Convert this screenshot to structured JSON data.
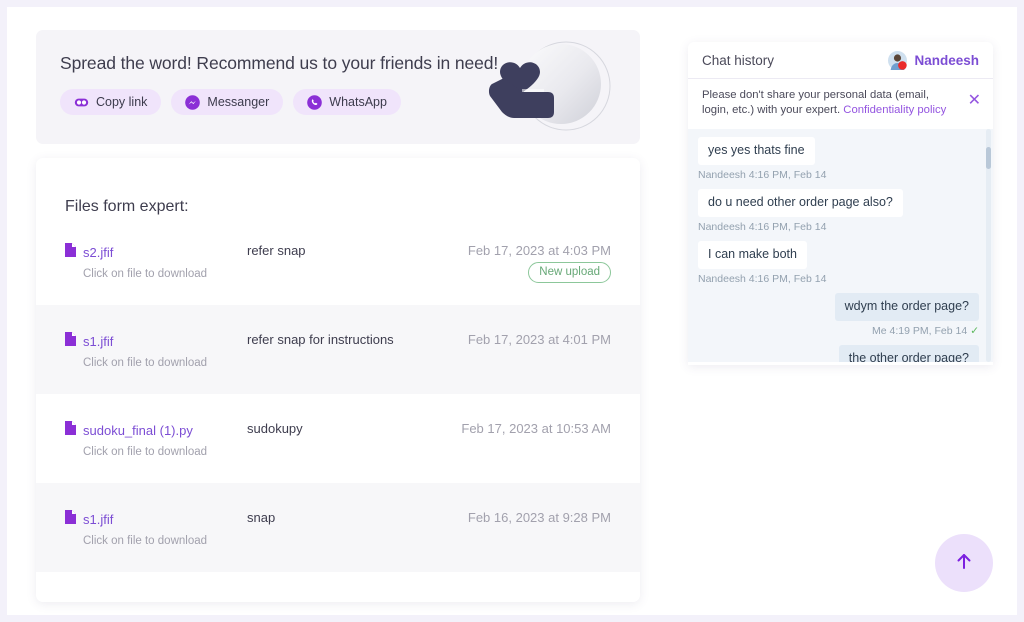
{
  "referral": {
    "title": "Spread the word! Recommend us to your friends in need!",
    "buttons": [
      {
        "label": "Copy link",
        "icon": "link-icon"
      },
      {
        "label": "Messanger",
        "icon": "messenger-icon"
      },
      {
        "label": "WhatsApp",
        "icon": "whatsapp-icon"
      }
    ],
    "illustration": "heart-in-hand-icon",
    "accent_color": "#7c4dd4",
    "pill_bg": "#f0e4fb"
  },
  "files": {
    "heading": "Files form expert:",
    "download_hint": "Click on file to download",
    "new_upload_label": "New upload",
    "rows": [
      {
        "name": "s2.jfif",
        "hint": "Click on file to download",
        "comment": "refer snap",
        "date": "Feb 17, 2023 at 4:03 PM",
        "badge": "New upload"
      },
      {
        "name": "s1.jfif",
        "hint": "Click on file to download",
        "comment": "refer snap for instructions",
        "date": "Feb 17, 2023 at 4:01 PM",
        "badge": ""
      },
      {
        "name": "sudoku_final (1).py",
        "hint": "Click on file to download",
        "comment": "sudokupy",
        "date": "Feb 17, 2023 at 10:53 AM",
        "badge": ""
      },
      {
        "name": "s1.jfif",
        "hint": "Click on file to download",
        "comment": "snap",
        "date": "Feb 16, 2023 at 9:28 PM",
        "badge": ""
      }
    ]
  },
  "chat": {
    "title": "Chat history",
    "expert_name": "Nandeesh",
    "privacy_notice": "Please don't share your personal data (email, login, etc.) with your expert. ",
    "privacy_link": "Confidentiality policy",
    "close_icon": "✕",
    "messages": [
      {
        "direction": "in",
        "text": "yes yes thats fine",
        "meta": "Nandeesh 4:16 PM, Feb 14",
        "tick": ""
      },
      {
        "direction": "in",
        "text": "do u need other order page also?",
        "meta": "Nandeesh 4:16 PM, Feb 14",
        "tick": ""
      },
      {
        "direction": "in",
        "text": "I can make both",
        "meta": "Nandeesh 4:16 PM, Feb 14",
        "tick": ""
      },
      {
        "direction": "out",
        "text": "wdym the order page?",
        "meta": "Me 4:19 PM, Feb 14",
        "tick": "✓"
      },
      {
        "direction": "out",
        "text": "the other order page?",
        "meta": "",
        "tick": ""
      }
    ]
  },
  "scroll_top": {
    "icon": "arrow-up-icon",
    "color": "#7c1fe0"
  }
}
